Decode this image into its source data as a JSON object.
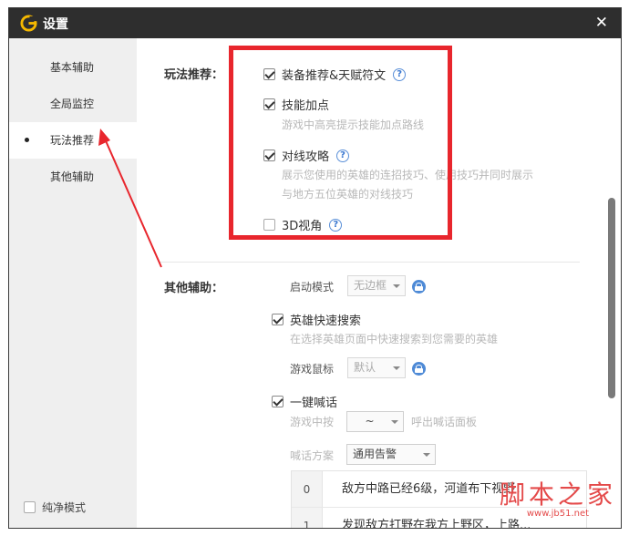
{
  "window": {
    "title": "设置",
    "close_glyph": "✕"
  },
  "sidebar": {
    "items": [
      {
        "label": "基本辅助",
        "active": false
      },
      {
        "label": "全局监控",
        "active": false
      },
      {
        "label": "玩法推荐",
        "active": true
      },
      {
        "label": "其他辅助",
        "active": false
      }
    ],
    "pure_mode": {
      "label": "纯净模式",
      "checked": false
    }
  },
  "gameplay": {
    "section_label": "玩法推荐：",
    "options": [
      {
        "label": "装备推荐&天赋符文",
        "checked": true,
        "help": "?"
      },
      {
        "label": "技能加点",
        "checked": true,
        "desc": [
          "游戏中高亮提示技能加点路线"
        ]
      },
      {
        "label": "对线攻略",
        "checked": true,
        "help": "?",
        "desc": [
          "展示您使用的英雄的连招技巧、使用技巧并同时展示",
          "与地方五位英雄的对线技巧"
        ]
      },
      {
        "label": "3D视角",
        "checked": false,
        "help": "?"
      }
    ]
  },
  "other": {
    "section_label": "其他辅助：",
    "launch_mode": {
      "label": "启动模式",
      "value": "无边框"
    },
    "hero_search": {
      "label": "英雄快速搜索",
      "checked": true,
      "desc": "在选择英雄页面中快速搜索到您需要的英雄"
    },
    "mouse": {
      "label": "游戏鼠标",
      "value": "默认"
    },
    "one_key_shout": {
      "label": "一键喊话",
      "checked": true
    },
    "shout_key": {
      "prefix": "游戏中按",
      "value": "~",
      "suffix": "呼出喊话面板"
    },
    "shout_scheme": {
      "label": "喊话方案",
      "value": "通用告警"
    },
    "phrases": [
      {
        "index": "0",
        "text": "敌方中路已经6级，河道布下视野！"
      },
      {
        "index": "1",
        "text": "发现敌方打野在我方上野区，上路..."
      }
    ]
  },
  "watermark": {
    "text": "脚本之家",
    "url": "www.jb51.net"
  },
  "colors": {
    "titlebar": "#2e2e2e",
    "highlight": "#e8262d",
    "accent": "#4e8ad6",
    "logo": "#f5b800"
  },
  "icons": {
    "logo": "g-logo-icon",
    "lock": "lock-icon",
    "help": "help-icon",
    "close": "close-icon"
  }
}
